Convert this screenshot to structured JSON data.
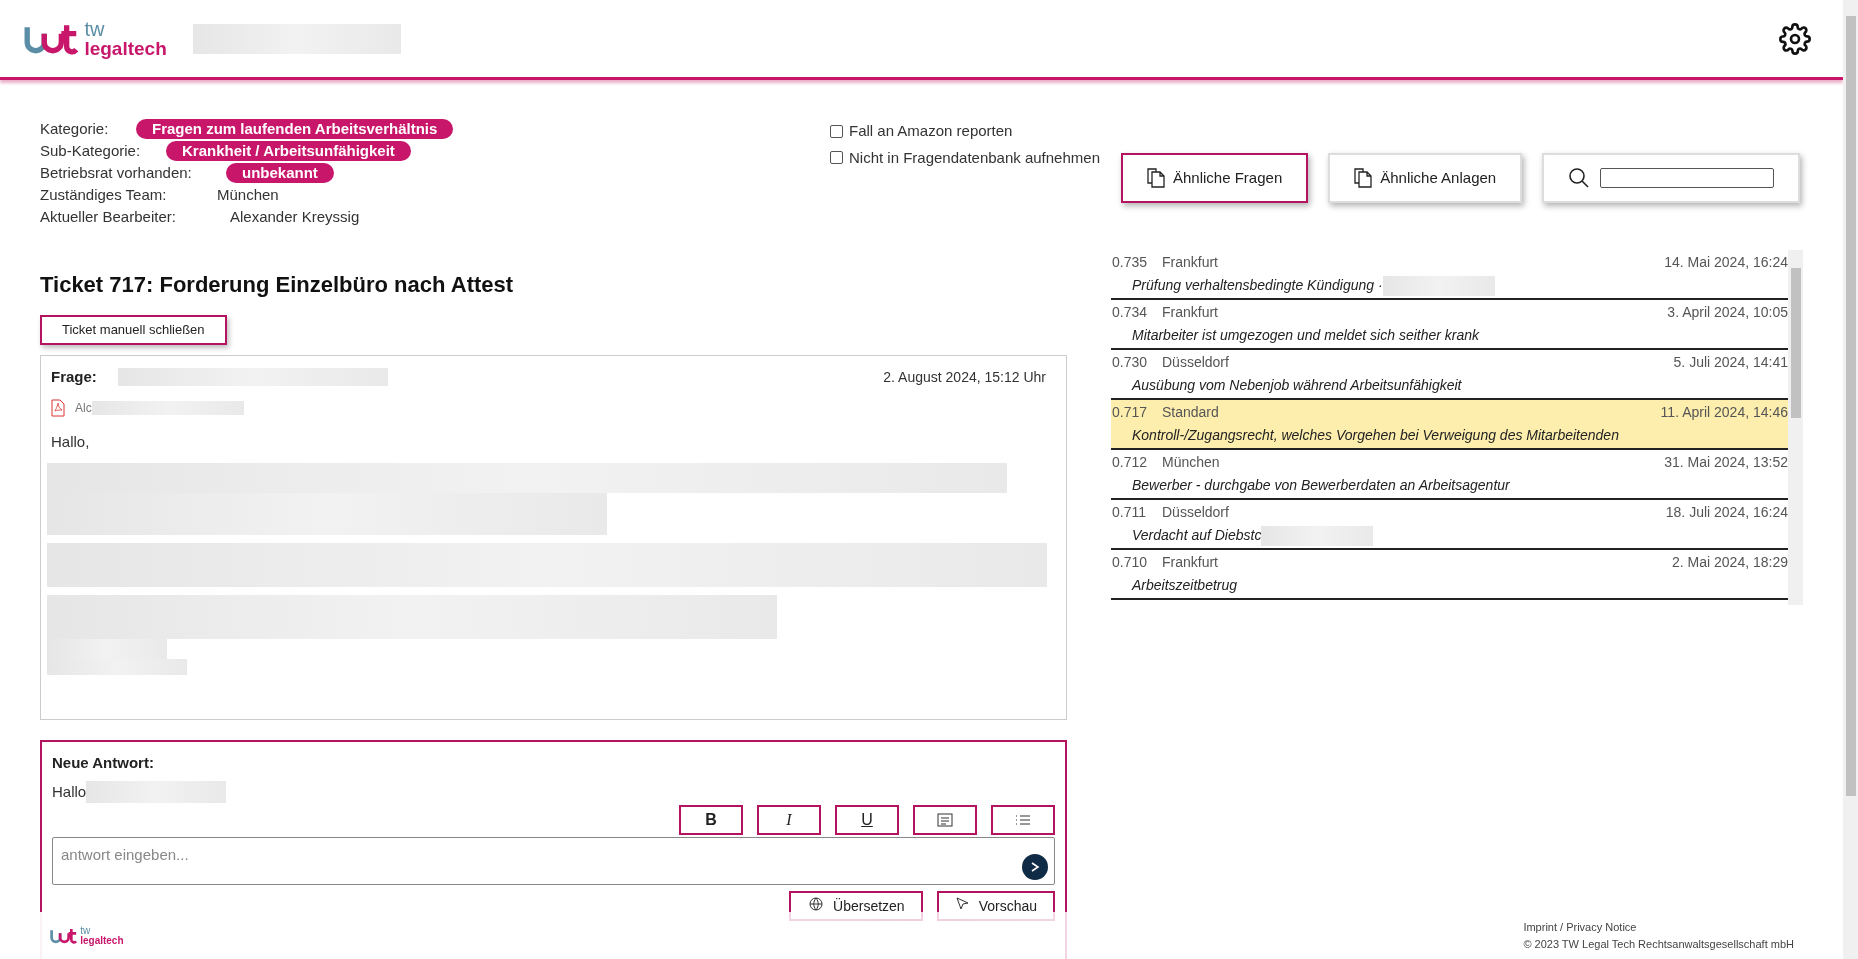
{
  "header": {
    "logo_small": "tw",
    "logo_name": "legaltech",
    "redacted": true
  },
  "meta": [
    {
      "label": "Kategorie:",
      "value": "Fragen zum laufenden Arbeitsverhältnis",
      "kind": "pill"
    },
    {
      "label": "Sub-Kategorie:",
      "value": "Krankheit / Arbeitsunfähigkeit",
      "kind": "pill"
    },
    {
      "label": "Betriebsrat vorhanden:",
      "value": "unbekannt",
      "kind": "pill"
    },
    {
      "label": "Zuständiges Team:",
      "value": "München",
      "kind": "text"
    },
    {
      "label": "Aktueller Bearbeiter:",
      "value": "Alexander Kreyssig",
      "kind": "text"
    }
  ],
  "options": [
    {
      "label": "Fall an Amazon reporten",
      "checked": false
    },
    {
      "label": "Nicht in Fragendatenbank aufnehmen",
      "checked": false
    }
  ],
  "tools": [
    {
      "label": "Ähnliche Fragen",
      "selected": true
    },
    {
      "label": "Ähnliche Anlagen",
      "selected": false
    }
  ],
  "results": [
    {
      "score": "0.735",
      "team": "Frankfurt",
      "date": "14. Mai 2024, 16:24",
      "title": "Prüfung verhaltensbedingte Kündigung ·",
      "redacted": true,
      "selected": false
    },
    {
      "score": "0.734",
      "team": "Frankfurt",
      "date": "3. April 2024, 10:05",
      "title": "Mitarbeiter ist umgezogen und meldet sich seither krank",
      "redacted": false,
      "selected": false
    },
    {
      "score": "0.730",
      "team": "Düsseldorf",
      "date": "5. Juli 2024, 14:41",
      "title": "Ausübung vom Nebenjob während Arbeitsunfähigkeit",
      "redacted": false,
      "selected": false
    },
    {
      "score": "0.717",
      "team": "Standard",
      "date": "11. April 2024, 14:46",
      "title": "Kontroll-/Zugangsrecht, welches Vorgehen bei Verweigung des Mitarbeitenden",
      "redacted": false,
      "selected": true
    },
    {
      "score": "0.712",
      "team": "München",
      "date": "31. Mai 2024, 13:52",
      "title": "Bewerber - durchgabe von Bewerberdaten an Arbeitsagentur",
      "redacted": false,
      "selected": false
    },
    {
      "score": "0.711",
      "team": "Düsseldorf",
      "date": "18. Juli 2024, 16:24",
      "title": "Verdacht auf Diebstc",
      "redacted": true,
      "selected": false
    },
    {
      "score": "0.710",
      "team": "Frankfurt",
      "date": "2. Mai 2024, 18:29",
      "title": "Arbeitszeitbetrug",
      "redacted": false,
      "selected": false
    }
  ],
  "ticket": {
    "title": "Ticket 717: Forderung Einzelbüro nach Attest",
    "close_button": "Ticket manuell schließen",
    "question": {
      "label": "Frage:",
      "date": "2. August 2024, 15:12 Uhr",
      "attachment": "Alc",
      "greeting": "Hallo,"
    }
  },
  "answer": {
    "label": "Neue Antwort:",
    "greeting": "Hallo",
    "format_buttons": [
      {
        "kind": "bold",
        "glyph": "B"
      },
      {
        "kind": "italic",
        "glyph": "I"
      },
      {
        "kind": "underline",
        "glyph": "U"
      },
      {
        "kind": "block"
      },
      {
        "kind": "list"
      }
    ],
    "placeholder": "antwort eingeben...",
    "buttons": [
      {
        "label": "Übersetzen",
        "kind": "translate"
      },
      {
        "label": "Vorschau",
        "kind": "preview"
      }
    ]
  },
  "footer": {
    "logo_small": "tw",
    "logo_name": "legaltech",
    "links": "Imprint / Privacy Notice",
    "copyright": "© 2023 TW Legal Tech Rechtsanwaltsgesellschaft mbH"
  }
}
